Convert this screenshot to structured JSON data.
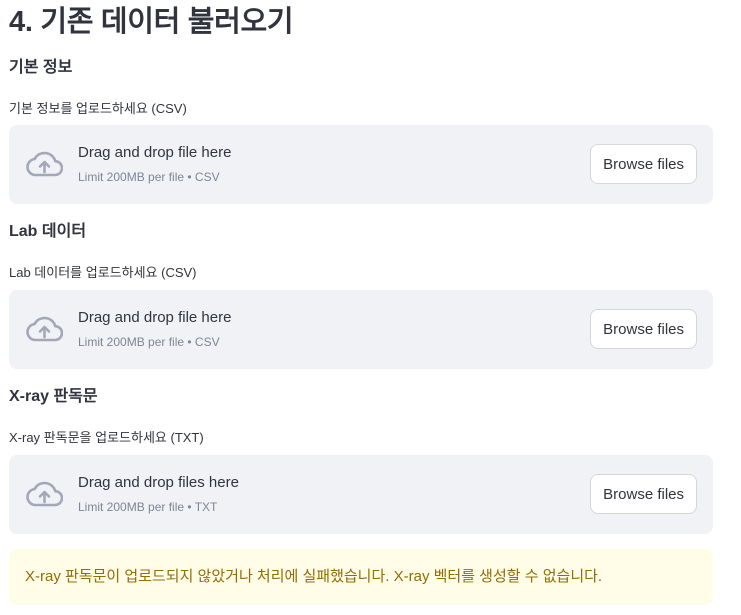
{
  "page": {
    "title": "4. 기존 데이터 불러오기"
  },
  "sections": [
    {
      "heading": "기본 정보",
      "uploader_label": "기본 정보를 업로드하세요 (CSV)",
      "drop_text": "Drag and drop file here",
      "limit_text": "Limit 200MB per file • CSV",
      "browse_label": "Browse files"
    },
    {
      "heading": "Lab 데이터",
      "uploader_label": "Lab 데이터를 업로드하세요 (CSV)",
      "drop_text": "Drag and drop file here",
      "limit_text": "Limit 200MB per file • CSV",
      "browse_label": "Browse files"
    },
    {
      "heading": "X-ray 판독문",
      "uploader_label": "X-ray 판독문을 업로드하세요 (TXT)",
      "drop_text": "Drag and drop files here",
      "limit_text": "Limit 200MB per file • TXT",
      "browse_label": "Browse files"
    }
  ],
  "warning": {
    "text": "X-ray 판독문이 업로드되지 않았거나 처리에 실패했습니다. X-ray 벡터를 생성할 수 없습니다.",
    "color": "#926c05",
    "background": "#fffce7"
  },
  "icons": {
    "upload": "cloud-upload-icon"
  },
  "colors": {
    "dropzone_bg": "#f0f2f6",
    "icon": "#a3a8b8",
    "text": "#31333f",
    "muted": "#808495"
  }
}
